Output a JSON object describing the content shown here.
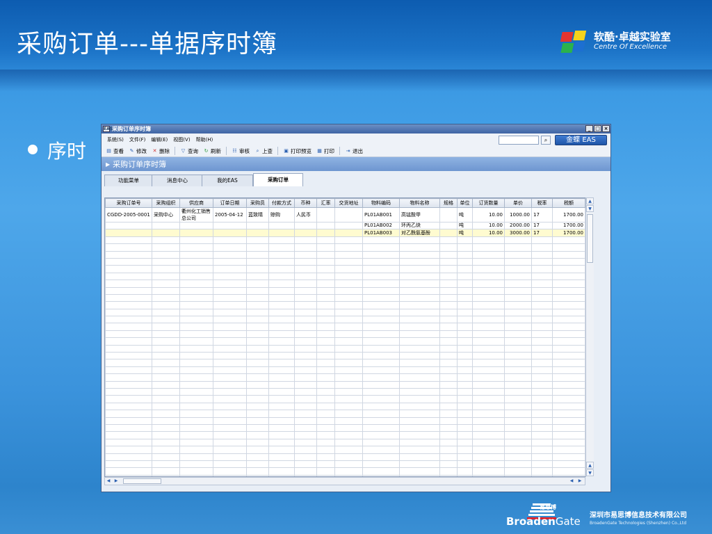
{
  "slide": {
    "title": "采购订单---单据序时簿",
    "bullet": "序时",
    "logo_cn": "软酷·卓越实验室",
    "logo_en": "Centre Of Excellence",
    "footer_brand_cn": "易思博",
    "footer_brand_a": "Broaden",
    "footer_brand_b": "Gate",
    "footer_company_cn": "深圳市易思博信息技术有限公司",
    "footer_company_en": "BroadenGate Technologies (Shenzhen) Co.,Ltd"
  },
  "window": {
    "title": "采购订单序时簿",
    "app_icon": "EAS",
    "min_label": "_",
    "max_label": "□",
    "close_label": "×"
  },
  "menu": [
    "系统(S)",
    "文件(F)",
    "编辑(E)",
    "视图(V)",
    "帮助(H)"
  ],
  "search": {
    "placeholder": "",
    "button_icon": "search-icon"
  },
  "brand_button": "金蝶 EAS",
  "toolbar": [
    {
      "label": "查看",
      "icon": "view-icon",
      "glyph": "▤"
    },
    {
      "label": "修改",
      "icon": "edit-icon",
      "glyph": "✎"
    },
    {
      "label": "删除",
      "icon": "delete-icon",
      "glyph": "✕"
    },
    {
      "label": "查询",
      "icon": "filter-icon",
      "glyph": "▽"
    },
    {
      "label": "刷新",
      "icon": "refresh-icon",
      "glyph": "↻"
    },
    {
      "label": "审核",
      "icon": "audit-icon",
      "glyph": "☷"
    },
    {
      "label": "上查",
      "icon": "trace-up-icon",
      "glyph": "⌕"
    },
    {
      "label": "打印预览",
      "icon": "print-preview-icon",
      "glyph": "▣"
    },
    {
      "label": "打印",
      "icon": "print-icon",
      "glyph": "▦"
    },
    {
      "label": "退出",
      "icon": "exit-icon",
      "glyph": "⇥"
    }
  ],
  "section_title": "采购订单序时簿",
  "tabs": [
    "功能菜单",
    "消息中心",
    "我的EAS",
    "采购订单"
  ],
  "table": {
    "columns": [
      "采购订单号",
      "采购组织",
      "供应商",
      "订单日期",
      "采购员",
      "付款方式",
      "币种",
      "汇率",
      "交货地址",
      "物料编码",
      "物料名称",
      "规格",
      "单位",
      "订货数量",
      "单价",
      "税率",
      "税额"
    ],
    "rows": [
      [
        "CGDD-2005-0001",
        "采购中心",
        "衢州化工销售总公司",
        "2005-04-12",
        "蓝致晴",
        "赊购",
        "人民币",
        "",
        "",
        "PL01AB001",
        "高锰酸甲",
        "",
        "吨",
        "10.00",
        "1000.00",
        "17",
        "1700.00"
      ],
      [
        "",
        "",
        "",
        "",
        "",
        "",
        "",
        "",
        "",
        "PL01AB002",
        "环丙乙炔",
        "",
        "吨",
        "10.00",
        "2000.00",
        "17",
        "1700.00"
      ],
      [
        "",
        "",
        "",
        "",
        "",
        "",
        "",
        "",
        "",
        "PL01AB003",
        "对乙酰氨基酚",
        "",
        "吨",
        "10.00",
        "3000.00",
        "17",
        "1700.00"
      ]
    ]
  },
  "colors": {
    "accent": "#1e55a8",
    "title_band": "#1668be",
    "selected_row": "#fffbd0"
  }
}
